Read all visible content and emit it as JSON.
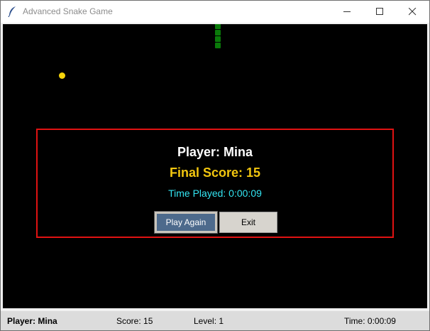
{
  "window": {
    "title": "Advanced Snake Game",
    "icons": {
      "app": "feather-icon",
      "minimize": "minimize-icon",
      "maximize": "maximize-icon",
      "close": "close-icon"
    }
  },
  "game": {
    "background_color": "#000000",
    "snake_color": "#0a7a0a",
    "snake_segments": 4,
    "food_color": "#f5d40b"
  },
  "game_over_panel": {
    "player_text": "Player: Mina",
    "final_score_text": "Final Score: 15",
    "time_played_text": "Time Played: 0:00:09",
    "play_again_label": "Play Again",
    "exit_label": "Exit",
    "border_color": "#e01212",
    "score_color": "#f2c60f",
    "time_color": "#33e5f2"
  },
  "status_bar": {
    "player": "Player: Mina",
    "score": "Score: 15",
    "level": "Level: 1",
    "time": "Time: 0:00:09"
  }
}
